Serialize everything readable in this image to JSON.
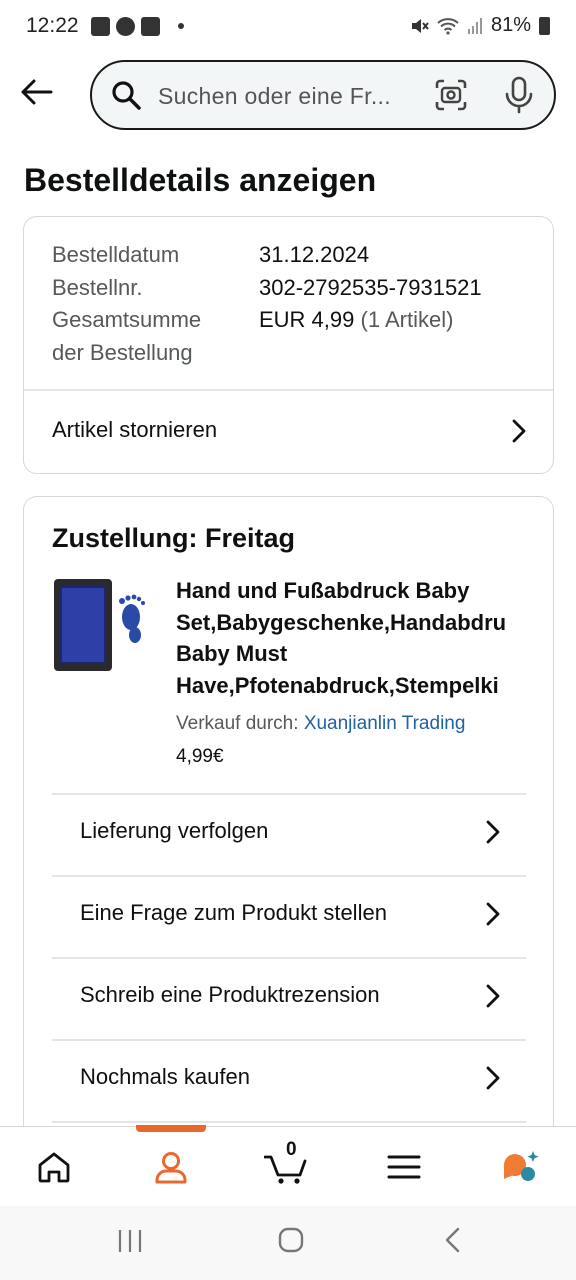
{
  "status_bar": {
    "time": "12:22",
    "battery": "81%"
  },
  "search": {
    "placeholder": "Suchen oder eine Fr..."
  },
  "page": {
    "title": "Bestelldetails anzeigen"
  },
  "order_info": {
    "rows": [
      {
        "label": "Bestelldatum",
        "value": "31.12.2024"
      },
      {
        "label": "Bestellnr.",
        "value": "302-2792535-7931521"
      },
      {
        "label": "Gesamtsumme",
        "value": "EUR 4,99",
        "extra": "(1 Artikel)"
      },
      {
        "label": "der Bestellung",
        "value": ""
      }
    ],
    "cancel_label": "Artikel stornieren"
  },
  "delivery": {
    "title": "Zustellung: Freitag",
    "product": {
      "title_lines": [
        "Hand und Fußabdruck Baby",
        "Set,Babygeschenke,Handabdru",
        "Baby Must",
        "Have,Pfotenabdruck,Stempelki"
      ],
      "seller_prefix": "Verkauf durch:",
      "seller_name": "Xuanjianlin Trading",
      "price": "4,99€"
    },
    "actions": [
      "Lieferung verfolgen",
      "Eine Frage zum Produkt stellen",
      "Schreib eine Produktrezension",
      "Nochmals kaufen"
    ]
  },
  "bottom_nav": {
    "items": [
      "home-icon",
      "account-icon",
      "cart-icon",
      "menu-icon",
      "rufus-ai-icon"
    ],
    "cart_count": "0",
    "active_color": "#e9692c"
  },
  "colors": {
    "accent": "#e9692c",
    "link": "#2162a1",
    "text": "#0f1111",
    "muted": "#565959"
  }
}
